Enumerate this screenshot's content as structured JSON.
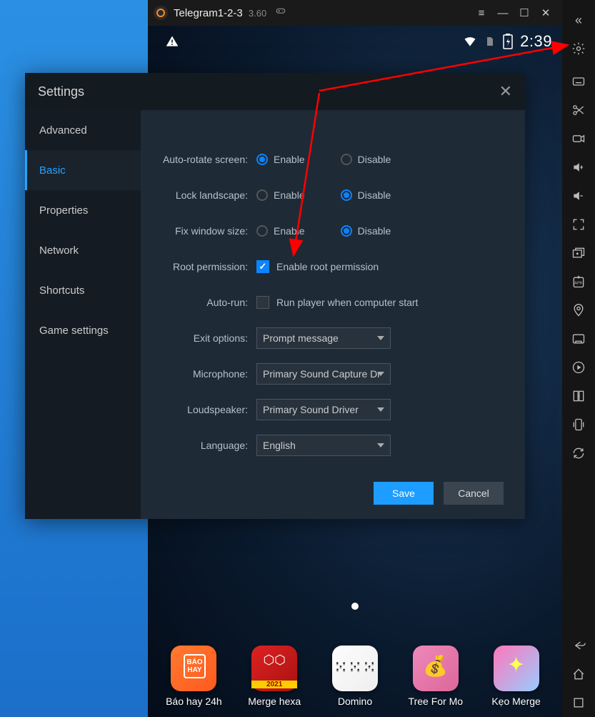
{
  "window": {
    "title": "Telegram1-2-3",
    "version": "3.60"
  },
  "statusbar": {
    "clock": "2:39"
  },
  "sidebar_tools": {
    "collapse": "«",
    "settings": "gear",
    "keyboard": "keyboard",
    "scissors": "scissors",
    "record": "camera",
    "volume_up": "vol+",
    "volume_down": "vol-",
    "fullscreen": "fullscreen",
    "multi": "multi",
    "apk": "apk",
    "location": "location",
    "screenshot": "screenshot",
    "operation": "operation",
    "sync": "sync",
    "shake": "shake",
    "rotate": "rotate",
    "back": "back",
    "home": "home",
    "recents": "recents"
  },
  "dock_apps": [
    {
      "label": "Báo hay 24h"
    },
    {
      "label": "Merge hexa"
    },
    {
      "label": "Domino"
    },
    {
      "label": "Tree For Mo"
    },
    {
      "label": "Kẹo Merge"
    }
  ],
  "settings": {
    "title": "Settings",
    "nav": [
      "Advanced",
      "Basic",
      "Properties",
      "Network",
      "Shortcuts",
      "Game settings"
    ],
    "active_nav": "Basic",
    "rows": {
      "auto_rotate": {
        "label": "Auto-rotate screen:",
        "enable": "Enable",
        "disable": "Disable",
        "value": "enable"
      },
      "lock_landscape": {
        "label": "Lock landscape:",
        "enable": "Enable",
        "disable": "Disable",
        "value": "disable"
      },
      "fix_window": {
        "label": "Fix window size:",
        "enable": "Enable",
        "disable": "Disable",
        "value": "disable"
      },
      "root": {
        "label": "Root permission:",
        "checkbox_label": "Enable root permission",
        "checked": true
      },
      "autorun": {
        "label": "Auto-run:",
        "checkbox_label": "Run player when computer start",
        "checked": false
      },
      "exit": {
        "label": "Exit options:",
        "value": "Prompt message"
      },
      "mic": {
        "label": "Microphone:",
        "value": "Primary Sound Capture Dr"
      },
      "speaker": {
        "label": "Loudspeaker:",
        "value": "Primary Sound Driver"
      },
      "lang": {
        "label": "Language:",
        "value": "English"
      }
    },
    "buttons": {
      "save": "Save",
      "cancel": "Cancel"
    }
  }
}
